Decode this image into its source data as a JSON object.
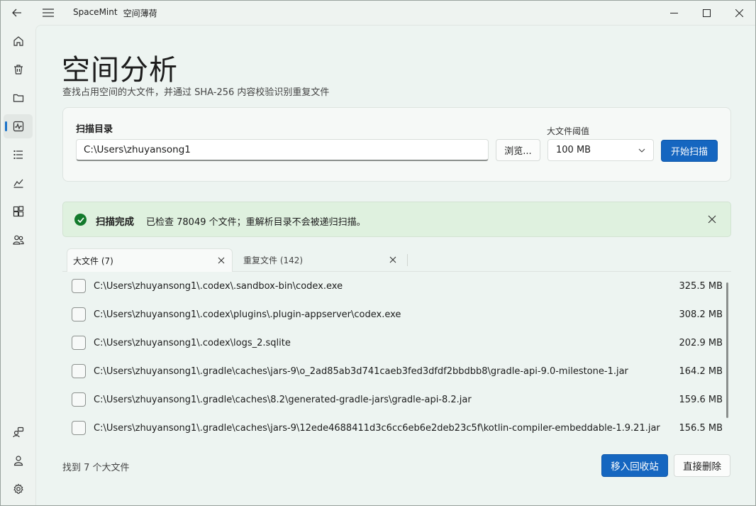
{
  "titlebar": {
    "app_name": "SpaceMint",
    "app_name_cn": "空间薄荷"
  },
  "nav": {
    "items": [
      {
        "icon": "home-icon"
      },
      {
        "icon": "trash-icon"
      },
      {
        "icon": "folder-icon"
      },
      {
        "icon": "activity-icon",
        "active": true
      },
      {
        "icon": "list-icon"
      },
      {
        "icon": "chart-icon"
      },
      {
        "icon": "apps-icon"
      },
      {
        "icon": "people-icon"
      }
    ],
    "bottom": [
      {
        "icon": "person-feedback-icon"
      },
      {
        "icon": "account-icon"
      },
      {
        "icon": "settings-icon"
      }
    ]
  },
  "page": {
    "title": "空间分析",
    "subtitle": "查找占用空间的大文件，并通过 SHA-256 内容校验识别重复文件"
  },
  "scan": {
    "dir_label": "扫描目录",
    "dir_value": "C:\\Users\\zhuyansong1",
    "browse_label": "浏览...",
    "threshold_label": "大文件阈值",
    "threshold_value": "100 MB",
    "start_label": "开始扫描"
  },
  "info": {
    "title": "扫描完成",
    "message": "已检查 78049 个文件；重解析目录不会被递归扫描。"
  },
  "tabs": [
    {
      "label": "大文件 (7)",
      "active": true
    },
    {
      "label": "重复文件 (142)",
      "active": false
    }
  ],
  "files": [
    {
      "path": "C:\\Users\\zhuyansong1\\.codex\\.sandbox-bin\\codex.exe",
      "size": "325.5 MB"
    },
    {
      "path": "C:\\Users\\zhuyansong1\\.codex\\plugins\\.plugin-appserver\\codex.exe",
      "size": "308.2 MB"
    },
    {
      "path": "C:\\Users\\zhuyansong1\\.codex\\logs_2.sqlite",
      "size": "202.9 MB"
    },
    {
      "path": "C:\\Users\\zhuyansong1\\.gradle\\caches\\jars-9\\o_2ad85ab3d741caeb3fed3dfdf2bbdbb8\\gradle-api-9.0-milestone-1.jar",
      "size": "164.2 MB"
    },
    {
      "path": "C:\\Users\\zhuyansong1\\.gradle\\caches\\8.2\\generated-gradle-jars\\gradle-api-8.2.jar",
      "size": "159.6 MB"
    },
    {
      "path": "C:\\Users\\zhuyansong1\\.gradle\\caches\\jars-9\\12ede4688411d3c6cc6eb6e2deb23c5f\\kotlin-compiler-embeddable-1.9.21.jar",
      "size": "156.5 MB"
    }
  ],
  "footer": {
    "count_text": "找到 7 个大文件",
    "recycle_label": "移入回收站",
    "delete_label": "直接删除"
  },
  "colors": {
    "accent": "#1566c0",
    "success_bg": "#dff1df",
    "success_icon": "#137a2c"
  }
}
